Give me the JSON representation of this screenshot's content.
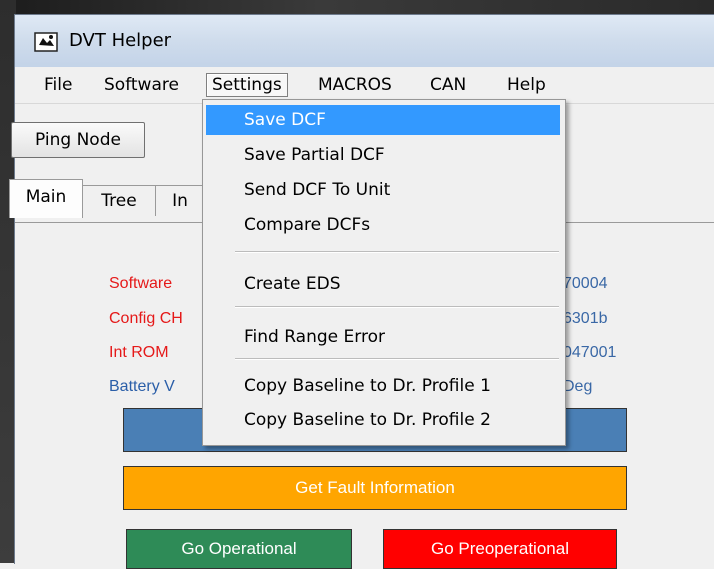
{
  "window": {
    "title": "DVT Helper"
  },
  "menubar": {
    "items": [
      {
        "label": "File"
      },
      {
        "label": "Software"
      },
      {
        "label": "Settings",
        "active": true
      },
      {
        "label": "MACROS"
      },
      {
        "label": "CAN"
      },
      {
        "label": "Help"
      }
    ]
  },
  "toolbar": {
    "ping_label": "Ping Node"
  },
  "tabs": [
    {
      "label": "Main",
      "active": true
    },
    {
      "label": "Tree"
    },
    {
      "label": "In"
    }
  ],
  "main": {
    "info": [
      {
        "label": "Software",
        "value": "70004",
        "color": "#e51919"
      },
      {
        "label": "Config CH",
        "value": "6301b",
        "color": "#e51919"
      },
      {
        "label": "Int ROM",
        "value": "047001",
        "color": "#e51919"
      },
      {
        "label": "Battery V",
        "value": "Deg",
        "color": "#2a5ea8"
      }
    ],
    "buttons": {
      "fault": "Get Fault Information",
      "operational": "Go Operational",
      "preoperational": "Go Preoperational"
    }
  },
  "settings_menu": {
    "items": [
      {
        "label": "Save DCF",
        "highlighted": true
      },
      {
        "label": "Save Partial DCF"
      },
      {
        "label": "Send DCF To Unit"
      },
      {
        "label": "Compare DCFs"
      },
      {
        "label": "Create EDS"
      },
      {
        "label": "Find Range Error"
      },
      {
        "label": "Copy Baseline to Dr. Profile 1"
      },
      {
        "label": "Copy Baseline to Dr. Profile 2"
      }
    ]
  },
  "colors": {
    "highlight": "#3399ff",
    "blue_button": "#4a7fb5",
    "orange_button": "#ffa500",
    "green_button": "#2e8b57",
    "red_button": "#ff0000"
  }
}
